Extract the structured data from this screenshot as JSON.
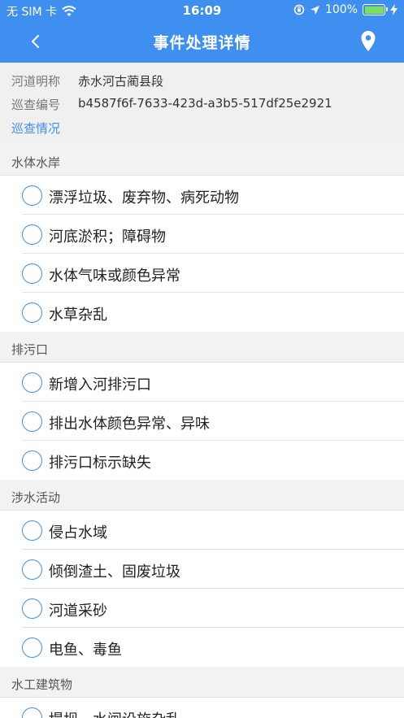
{
  "status_bar": {
    "carrier": "无 SIM 卡",
    "time": "16:09",
    "battery": "100%",
    "battery_level": 1.0,
    "icons": [
      "wifi-icon",
      "orientation-lock-icon",
      "location-arrow-icon",
      "battery-icon",
      "charging-icon"
    ]
  },
  "nav": {
    "title": "事件处理详情",
    "back_icon": "chevron-left-icon",
    "location_icon": "map-pin-icon"
  },
  "info": {
    "river_label": "河道明称",
    "river_value": "赤水河古蔺县段",
    "patrol_label": "巡查编号",
    "patrol_value": "b4587f6f-7633-423d-a3b5-517df25e2921",
    "patrol_link": "巡查情况"
  },
  "sections": [
    {
      "title": "水体水岸",
      "items": [
        "漂浮垃圾、废弃物、病死动物",
        "河底淤积；障碍物",
        "水体气味或颜色异常",
        "水草杂乱"
      ]
    },
    {
      "title": "排污口",
      "items": [
        "新增入河排污口",
        "排出水体颜色异常、异味",
        "排污口标示缺失"
      ]
    },
    {
      "title": "涉水活动",
      "items": [
        "侵占水域",
        "倾倒渣土、固废垃圾",
        "河道采砂",
        "电鱼、毒鱼"
      ]
    },
    {
      "title": "水工建筑物",
      "items": [
        "堤坝、水闸设施杂乱"
      ]
    }
  ],
  "colors": {
    "accent": "#3f8ff0",
    "background": "#f2f2f2",
    "battery_fill": "#7ee05b"
  }
}
